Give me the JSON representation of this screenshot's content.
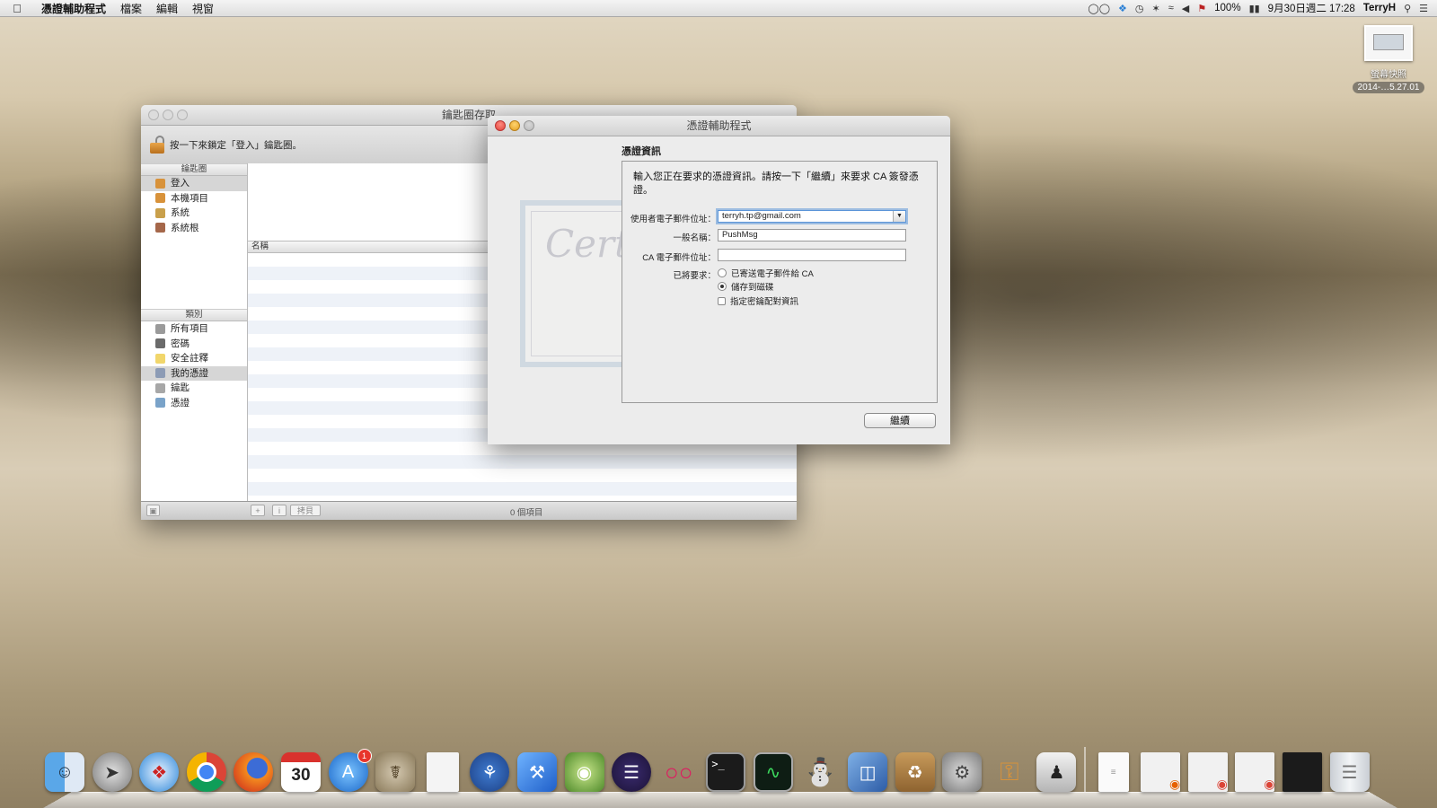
{
  "menubar": {
    "app": "憑證輔助程式",
    "items": [
      "檔案",
      "編輯",
      "視窗"
    ],
    "battery": "100%",
    "datetime": "9月30日週二 17:28",
    "user": "TerryH"
  },
  "desktop_icon": {
    "label": "螢幕快照",
    "sublabel": "2014-…5.27.01"
  },
  "keychain": {
    "title": "鑰匙圈存取",
    "lock_hint": "按一下來鎖定「登入」鑰匙圈。",
    "keychains_header": "鑰匙圈",
    "keychains": [
      "登入",
      "本機項目",
      "系統",
      "系統根"
    ],
    "category_header": "類別",
    "categories": [
      "所有項目",
      "密碼",
      "安全註釋",
      "我的憑證",
      "鑰匙",
      "憑證"
    ],
    "column_name": "名稱",
    "copy_button": "拷貝",
    "item_count": "0 個項目"
  },
  "cert_assistant": {
    "title": "憑證輔助程式",
    "section_title": "憑證資訊",
    "intro": "輸入您正在要求的憑證資訊。請按一下「繼續」來要求 CA 簽發憑證。",
    "email_label": "使用者電子郵件位址：",
    "email_value": "terryh.tp@gmail.com",
    "common_name_label": "一般名稱：",
    "common_name_value": "PushMsg",
    "ca_email_label": "CA 電子郵件位址：",
    "ca_email_value": "",
    "request_label": "已將要求：",
    "options": {
      "emailed": "已寄送電子郵件給 CA",
      "saved": "儲存到磁碟",
      "keypair": "指定密鑰配對資訊"
    },
    "selected_option": "saved",
    "continue_button": "繼續"
  },
  "dock": {
    "icons": [
      "finder-icon",
      "launchpad-icon",
      "safari-icon",
      "chrome-icon",
      "firefox-icon",
      "calendar-icon",
      "app-store-icon",
      "gimp-icon",
      "document-icon",
      "sourcetree-icon",
      "xcode-icon",
      "android-sdk-icon",
      "eclipse-icon",
      "flickr-icon",
      "terminal-icon",
      "activity-monitor-icon",
      "android-icon",
      "virtualbox-icon",
      "archive-utility-icon",
      "system-preferences-icon",
      "keychain-access-icon",
      "alfred-icon",
      "text-document-icon",
      "window-firefox-icon",
      "window-chrome-icon",
      "window-chrome-2-icon",
      "window-terminal-icon",
      "trash-icon"
    ],
    "calendar_day": "30",
    "app_store_badge": "1"
  }
}
